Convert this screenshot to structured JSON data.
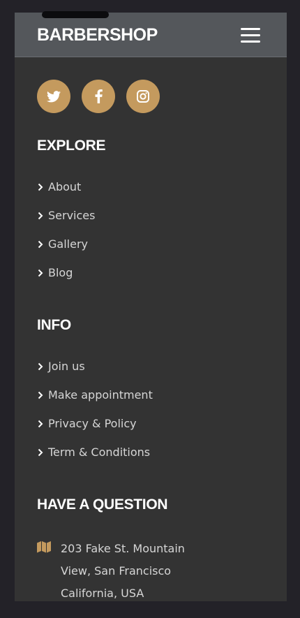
{
  "header": {
    "brand": "BARBERSHOP"
  },
  "social": [
    {
      "icon": "twitter-icon"
    },
    {
      "icon": "facebook-icon"
    },
    {
      "icon": "instagram-icon"
    }
  ],
  "explore": {
    "title": "EXPLORE",
    "items": [
      "About",
      "Services",
      "Gallery",
      "Blog"
    ]
  },
  "info": {
    "title": "INFO",
    "items": [
      "Join us",
      "Make appointment",
      "Privacy & Policy",
      "Term & Conditions"
    ]
  },
  "question": {
    "title": "HAVE A QUESTION",
    "address_lines": [
      "203 Fake St. Mountain",
      "View, San Francisco",
      "California, USA"
    ]
  },
  "colors": {
    "accent": "#c49a5e",
    "background": "#333333",
    "header": "#54575b",
    "text": "#d6d6d6"
  }
}
